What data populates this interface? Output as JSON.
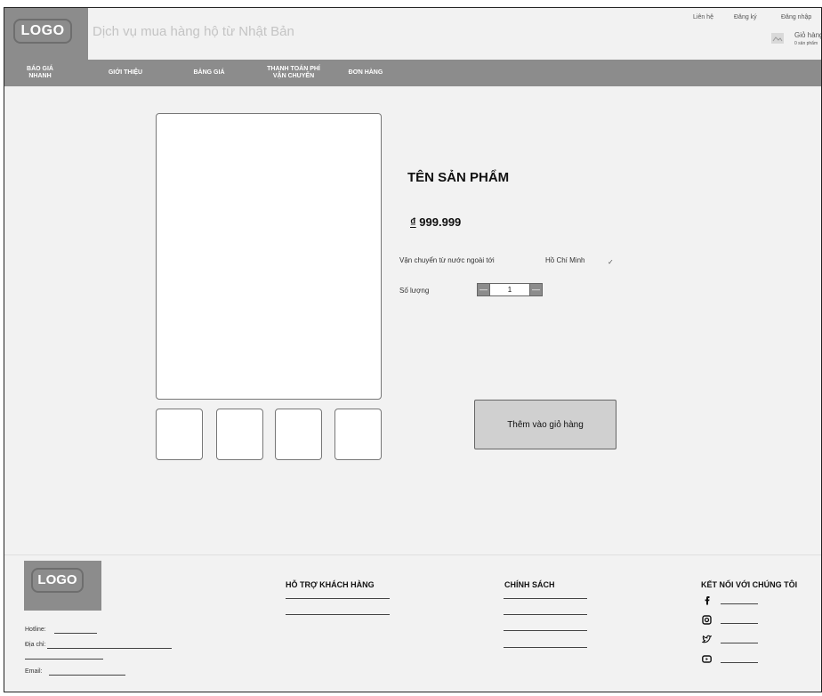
{
  "header": {
    "logo_text": "LOGO",
    "site_title": "Dịch vụ mua hàng hộ từ Nhật Bản",
    "top_links": [
      "Liên hệ",
      "Đăng ký",
      "Đăng nhập"
    ],
    "cart_title": "Giỏ hàng",
    "cart_count": "0 sản phẩm"
  },
  "nav": {
    "items": [
      {
        "label": "BÁO GIÁ\nNHANH"
      },
      {
        "label": "GIỚI THIỆU"
      },
      {
        "label": "BẢNG GIÁ"
      },
      {
        "label": "THANH TOÁN PHÍ\nVẬN CHUYỂN"
      },
      {
        "label": "ĐƠN HÀNG"
      }
    ]
  },
  "product": {
    "name": "TÊN SẢN PHẨM",
    "currency_symbol": "₫",
    "price": "999.999",
    "shipping_label": "Vận chuyển từ nước ngoài tới",
    "shipping_destination": "Hồ Chí Minh",
    "quantity_label": "Số lượng",
    "quantity": "1",
    "add_to_cart": "Thêm vào giỏ hàng"
  },
  "footer": {
    "logo_text": "LOGO",
    "hotline_label": "Hotline:",
    "address_label": "Địa chỉ:",
    "email_label": "Email:",
    "support_heading": "HỖ TRỢ KHÁCH HÀNG",
    "policy_heading": "CHÍNH SÁCH",
    "connect_heading": "KẾT NỐI VỚI CHÚNG TÔI",
    "social_icons": [
      "facebook-icon",
      "instagram-icon",
      "twitter-icon",
      "youtube-icon"
    ]
  },
  "colors": {
    "background": "#f2f2f2",
    "nav_bar": "#8c8c8c",
    "button": "#d0d0d0"
  }
}
